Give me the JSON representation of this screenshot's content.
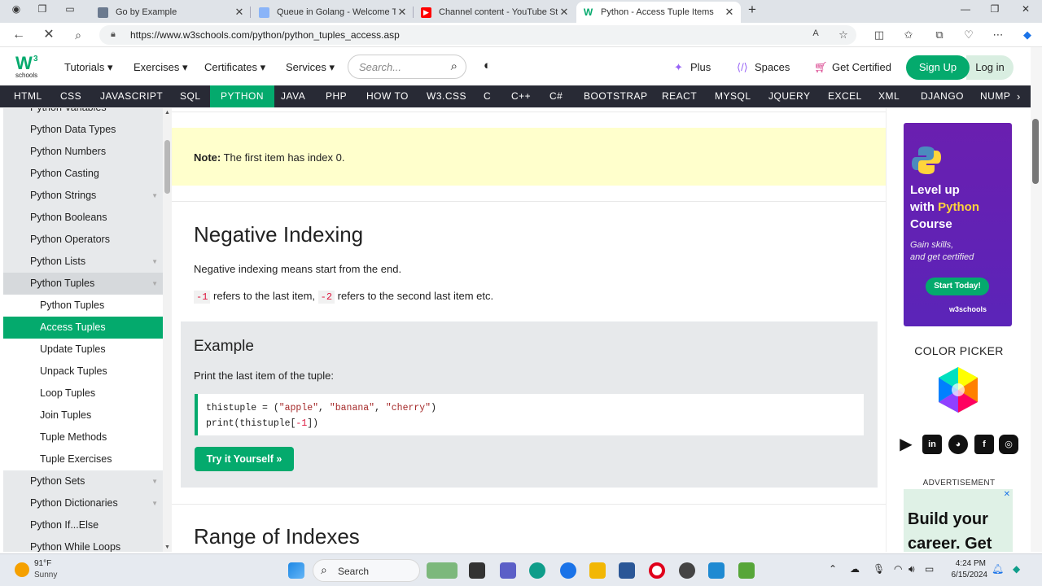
{
  "browser": {
    "tabs": [
      {
        "title": "Go by Example",
        "favicon_color": "#6b7a8f"
      },
      {
        "title": "Queue in Golang - Welcome To C",
        "favicon_color": "#8ab4f8"
      },
      {
        "title": "Channel content - YouTube Studi",
        "favicon_color": "#ff0000"
      },
      {
        "title": "Python - Access Tuple Items",
        "favicon_color": "#04aa6d"
      }
    ],
    "new_tab": "+",
    "url": "https://www.w3schools.com/python/python_tuples_access.asp"
  },
  "header": {
    "logo_text": "schools",
    "logo_sup": "3",
    "logo_w": "W",
    "menus": [
      "Tutorials",
      "Exercises",
      "Certificates",
      "Services"
    ],
    "search_placeholder": "Search...",
    "plus": "Plus",
    "spaces": "Spaces",
    "get_certified": "Get Certified",
    "sign_up": "Sign Up",
    "log_in": "Log in"
  },
  "langnav": [
    "HTML",
    "CSS",
    "JAVASCRIPT",
    "SQL",
    "PYTHON",
    "JAVA",
    "PHP",
    "HOW TO",
    "W3.CSS",
    "C",
    "C++",
    "C#",
    "BOOTSTRAP",
    "REACT",
    "MYSQL",
    "JQUERY",
    "EXCEL",
    "XML",
    "DJANGO",
    "NUMP"
  ],
  "sidebar": {
    "items": [
      {
        "label": "Python Variables",
        "level": 1
      },
      {
        "label": "Python Data Types",
        "level": 1
      },
      {
        "label": "Python Numbers",
        "level": 1
      },
      {
        "label": "Python Casting",
        "level": 1
      },
      {
        "label": "Python Strings",
        "level": 1,
        "caret": true
      },
      {
        "label": "Python Booleans",
        "level": 1
      },
      {
        "label": "Python Operators",
        "level": 1
      },
      {
        "label": "Python Lists",
        "level": 1,
        "caret": true
      },
      {
        "label": "Python Tuples",
        "level": 1,
        "caret": true,
        "open": true
      },
      {
        "label": "Python Tuples",
        "level": 2
      },
      {
        "label": "Access Tuples",
        "level": 2,
        "selected": true
      },
      {
        "label": "Update Tuples",
        "level": 2
      },
      {
        "label": "Unpack Tuples",
        "level": 2
      },
      {
        "label": "Loop Tuples",
        "level": 2
      },
      {
        "label": "Join Tuples",
        "level": 2
      },
      {
        "label": "Tuple Methods",
        "level": 2
      },
      {
        "label": "Tuple Exercises",
        "level": 2
      },
      {
        "label": "Python Sets",
        "level": 1,
        "caret": true
      },
      {
        "label": "Python Dictionaries",
        "level": 1,
        "caret": true
      },
      {
        "label": "Python If...Else",
        "level": 1
      },
      {
        "label": "Python While Loops",
        "level": 1
      }
    ]
  },
  "main": {
    "note_bold": "Note:",
    "note_text": " The first item has index 0.",
    "neg_heading": "Negative Indexing",
    "neg_para": "Negative indexing means start from the end.",
    "neg_code1": "-1",
    "neg_mid": " refers to the last item, ",
    "neg_code2": "-2",
    "neg_end": " refers to the second last item etc.",
    "example_heading": "Example",
    "example_desc": "Print the last item of the tuple:",
    "code_l1_a": "thistuple = (",
    "code_l1_s1": "\"apple\"",
    "code_l1_c1": ", ",
    "code_l1_s2": "\"banana\"",
    "code_l1_c2": ", ",
    "code_l1_s3": "\"cherry\"",
    "code_l1_e": ")",
    "code_l2_a": "print(thistuple[",
    "code_l2_n": "-1",
    "code_l2_e": "])",
    "try_button": "Try it Yourself »",
    "range_heading": "Range of Indexes"
  },
  "rail": {
    "ad_line1": "Level up",
    "ad_line2a": "with ",
    "ad_line2b": "Python",
    "ad_line3": "Course",
    "ad_sub1": "Gain skills,",
    "ad_sub2": "and get certified",
    "ad_button": "Start Today!",
    "ad_brand": "w3schools",
    "color_picker": "COLOR PICKER",
    "advertisement": "ADVERTISEMENT",
    "ad2_text1": "Build your",
    "ad2_text2": "career. Get"
  },
  "taskbar": {
    "weather_temp": "91°F",
    "weather_desc": "Sunny",
    "search": "Search",
    "time": "4:24 PM",
    "date": "6/15/2024"
  }
}
